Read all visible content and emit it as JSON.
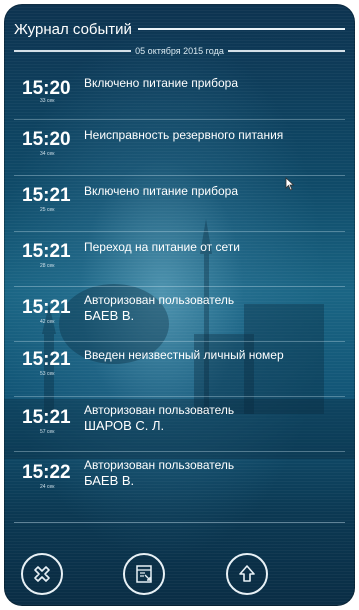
{
  "header": {
    "title": "Журнал событий"
  },
  "log": {
    "date": "05 октября 2015 года",
    "events": [
      {
        "time": "15:20",
        "seconds": "33 сек",
        "line1": "Включено питание прибора",
        "line2": ""
      },
      {
        "time": "15:20",
        "seconds": "34 сек",
        "line1": "Неисправность резервного питания",
        "line2": ""
      },
      {
        "time": "15:21",
        "seconds": "25 сек",
        "line1": "Включено питание прибора",
        "line2": ""
      },
      {
        "time": "15:21",
        "seconds": "28 сек",
        "line1": "Переход на питание от сети",
        "line2": ""
      },
      {
        "time": "15:21",
        "seconds": "42 сек",
        "line1": "Авторизован пользователь",
        "line2": "БАЕВ В."
      },
      {
        "time": "15:21",
        "seconds": "53 сек",
        "line1": "Введен неизвестный личный номер",
        "line2": ""
      },
      {
        "time": "15:21",
        "seconds": "57 сек",
        "line1": "Авторизован пользователь",
        "line2": "ШАРОВ С. Л."
      },
      {
        "time": "15:22",
        "seconds": "24 сек",
        "line1": "Авторизован пользователь",
        "line2": "БАЕВ В."
      }
    ]
  },
  "footer": {
    "buttons": [
      {
        "icon": "close-icon"
      },
      {
        "icon": "report-icon"
      },
      {
        "icon": "arrow-up-icon"
      }
    ]
  },
  "colors": {
    "background": "#0f4a68",
    "text": "#ffffff",
    "accent_line": "#eaf3f8"
  }
}
